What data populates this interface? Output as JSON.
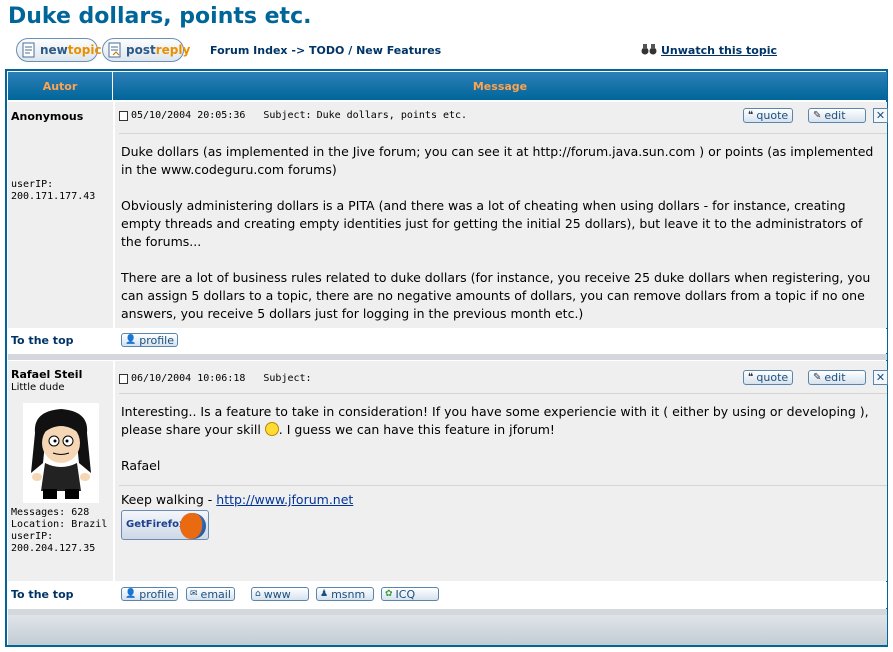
{
  "page": {
    "title": "Duke dollars, points etc."
  },
  "toolbar": {
    "newtopic_prefix": "new",
    "newtopic_suffix": "topic",
    "postreply_prefix": "post",
    "postreply_suffix": "reply"
  },
  "breadcrumb": {
    "forum_index": "Forum Index",
    "arrow": "->",
    "category": "TODO",
    "slash": "/",
    "forum": "New Features"
  },
  "watch": {
    "label": "Unwatch this topic"
  },
  "table": {
    "col_author": "Autor",
    "col_message": "Message"
  },
  "posts": [
    {
      "author": "Anonymous",
      "user_ip_label": "userIP:",
      "user_ip": "200.171.177.43",
      "date": "05/10/2004 20:05:36",
      "subject_label": "Subject:",
      "subject": "Duke dollars, points etc.",
      "paragraphs": [
        "Duke dollars (as implemented in the Jive forum; you can see it at http://forum.java.sun.com ) or points (as implemented in the www.codeguru.com forums)",
        "Obviously administering dollars is a PITA (and there was a lot of cheating when using dollars - for instance, creating empty threads and creating empty identities just for getting the initial 25 dollars), but leave it to the administrators of the forums...",
        "There are a lot of business rules related to duke dollars (for instance, you receive 25 duke dollars when registering, you can assign 5 dollars to a topic, there are no negative amounts of dollars, you can remove dollars from a topic if no one answers, you receive 5 dollars just for logging in the previous month etc.)"
      ],
      "to_top": "To the top",
      "buttons": [
        "profile"
      ]
    },
    {
      "author": "Rafael Steil",
      "rank": "Little dude",
      "messages_label": "Messages:",
      "messages": "628",
      "location_label": "Location:",
      "location": "Brazil",
      "user_ip_label": "userIP:",
      "user_ip": "200.204.127.35",
      "date": "06/10/2004 10:06:18",
      "subject_label": "Subject:",
      "subject": "",
      "line1": "Interesting.. Is a feature to take in consideration! If you have some experiencie with it ( either by using or developing ),",
      "line2_a": "please share your skill",
      "line2_b": ". I guess we can have this feature in jforum!",
      "signoff": "Rafael",
      "sig_text": "Keep walking -",
      "sig_link": "http://www.jforum.net",
      "firefox_label": "GetFirefox",
      "to_top": "To the top",
      "buttons": [
        "profile",
        "email",
        "www",
        "msnm",
        "ICQ"
      ]
    }
  ],
  "post_actions": {
    "quote": "quote",
    "edit": "edit",
    "delete": "✕"
  },
  "colors": {
    "accent": "#006699",
    "header_text": "#ffa34f",
    "link": "#003366"
  }
}
